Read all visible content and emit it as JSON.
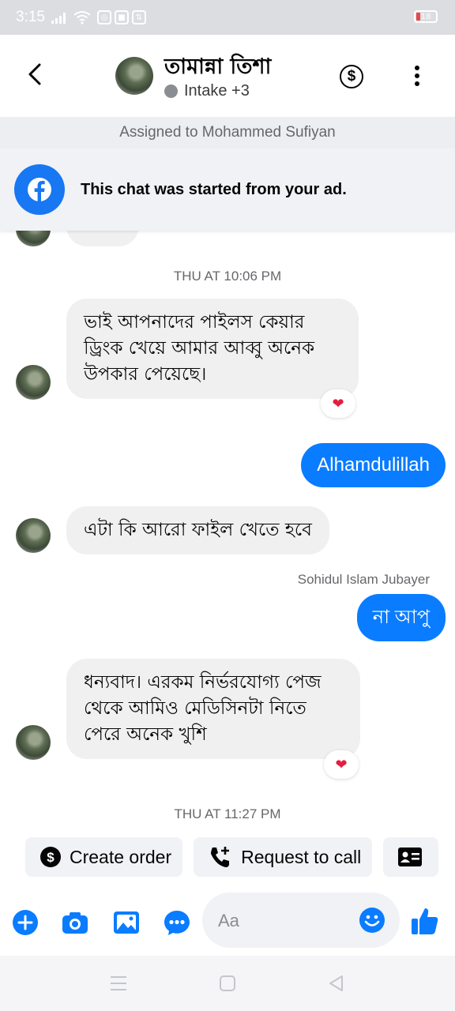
{
  "status_bar": {
    "time": "3:15",
    "battery": "18"
  },
  "header": {
    "contact_name": "তামান্না তিশা",
    "label": "Intake +3"
  },
  "assigned_text": "Assigned to Mohammed Sufiyan",
  "ad_banner": {
    "text": "This chat was started from your ad."
  },
  "messages": {
    "timestamp_1": "THU AT 10:06 PM",
    "in_1": [
      "ভাই আপনাদের পাইলস কেয়ার",
      "ড্রিংক খেয়ে আমার আব্বু অনেক",
      "উপকার পেয়েছে।"
    ],
    "out_1": "Alhamdulillah",
    "in_2": "এটা কি আরো ফাইল খেতে হবে",
    "sender_1": "Sohidul Islam Jubayer",
    "out_2": "না আপু",
    "in_3": [
      "ধন্যবাদ। এরকম নির্ভরযোগ্য পেজ",
      "থেকে আমিও মেডিসিনটা নিতে",
      "পেরে অনেক খুশি"
    ],
    "timestamp_2": "THU AT 11:27 PM",
    "reaction": "❤"
  },
  "actions": {
    "create_order": "Create order",
    "request_call": "Request to call"
  },
  "composer": {
    "placeholder": "Aa"
  },
  "colors": {
    "accent": "#0a7cff",
    "facebook_blue": "#1877f2",
    "incoming_bubble": "#f0f0f0",
    "heart": "#e41e3f"
  }
}
